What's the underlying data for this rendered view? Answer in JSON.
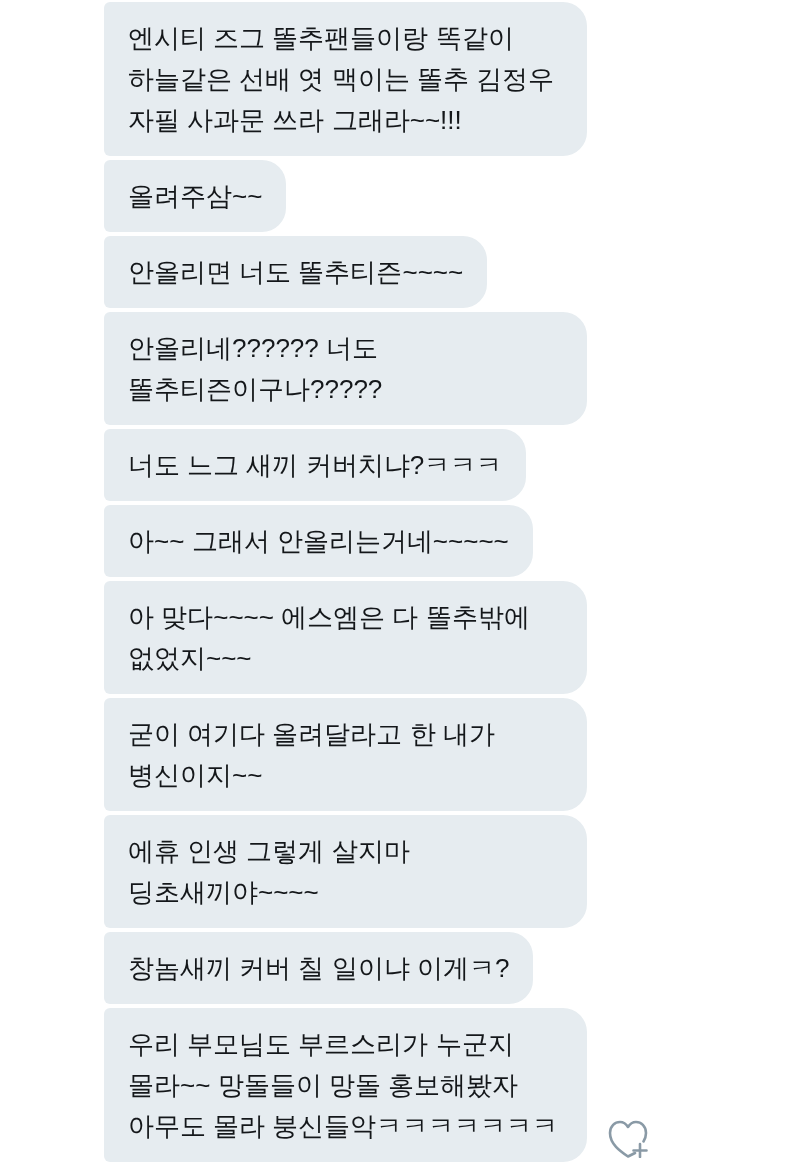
{
  "messages": [
    {
      "text": "엔시티 즈그 똘추팬들이랑 똑같이 하늘같은 선배 엿 맥이는 똘추 김정우 자필 사과문 쓰라 그래라~~!!!"
    },
    {
      "text": "올려주삼~~"
    },
    {
      "text": "안올리면 너도 똘추티즌~~~~"
    },
    {
      "text": "안올리네?????? 너도 똘추티즌이구나?????"
    },
    {
      "text": "너도 느그 새끼 커버치냐?ㅋㅋㅋ"
    },
    {
      "text": "아~~ 그래서 안올리는거네~~~~~"
    },
    {
      "text": "아 맞다~~~~ 에스엠은 다 똘추밖에 없었지~~~"
    },
    {
      "text": "굳이 여기다 올려달라고 한 내가 병신이지~~"
    },
    {
      "text": "에휴 인생 그렇게 살지마 딩초새끼야~~~~"
    },
    {
      "text": "창놈새끼 커버 칠 일이냐 이게ㅋ?"
    },
    {
      "text": "우리 부모님도 부르스리가 누군지 몰라~~ 망돌들이 망돌 홍보해봤자 아무도 몰라 붕신들악ㅋㅋㅋㅋㅋㅋㅋ"
    }
  ]
}
